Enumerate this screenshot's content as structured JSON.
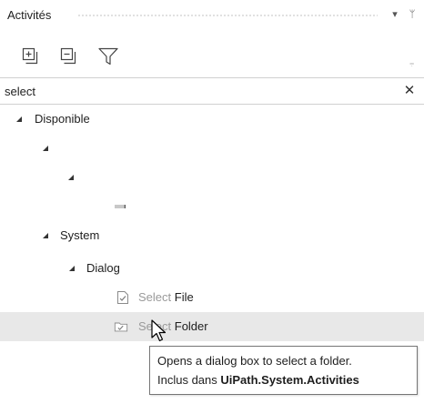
{
  "panel": {
    "title": "Activités",
    "pin_glyph": "ᛘ",
    "dropdown_glyph": "▾"
  },
  "toolbar": {
    "expand_all_icon": "expand-all-icon",
    "collapse_all_icon": "collapse-all-icon",
    "filter_icon": "filter-icon",
    "overflow_glyph": "⩦"
  },
  "search": {
    "value": "select",
    "clear_glyph": "✕"
  },
  "tree": {
    "root": {
      "label": "Disponible",
      "expanded": true
    },
    "blank_1": {
      "label": "",
      "expanded": true
    },
    "blank_2": {
      "label": "",
      "expanded": true
    },
    "system": {
      "label": "System",
      "expanded": true
    },
    "dialog": {
      "label": "Dialog",
      "expanded": true
    },
    "items": [
      {
        "match": "Select",
        "rest": " File",
        "icon": "select-file-icon",
        "highlighted": false
      },
      {
        "match": "Select",
        "rest": " Folder",
        "icon": "select-folder-icon",
        "highlighted": true
      }
    ]
  },
  "tooltip": {
    "line1": "Opens a dialog box to select a folder.",
    "line2_prefix": "Inclus dans ",
    "line2_package": "UiPath.System.Activities"
  },
  "colors": {
    "highlight_row": "#e8e8e8",
    "match_text": "#9a9a9a",
    "tooltip_border": "#767676"
  }
}
